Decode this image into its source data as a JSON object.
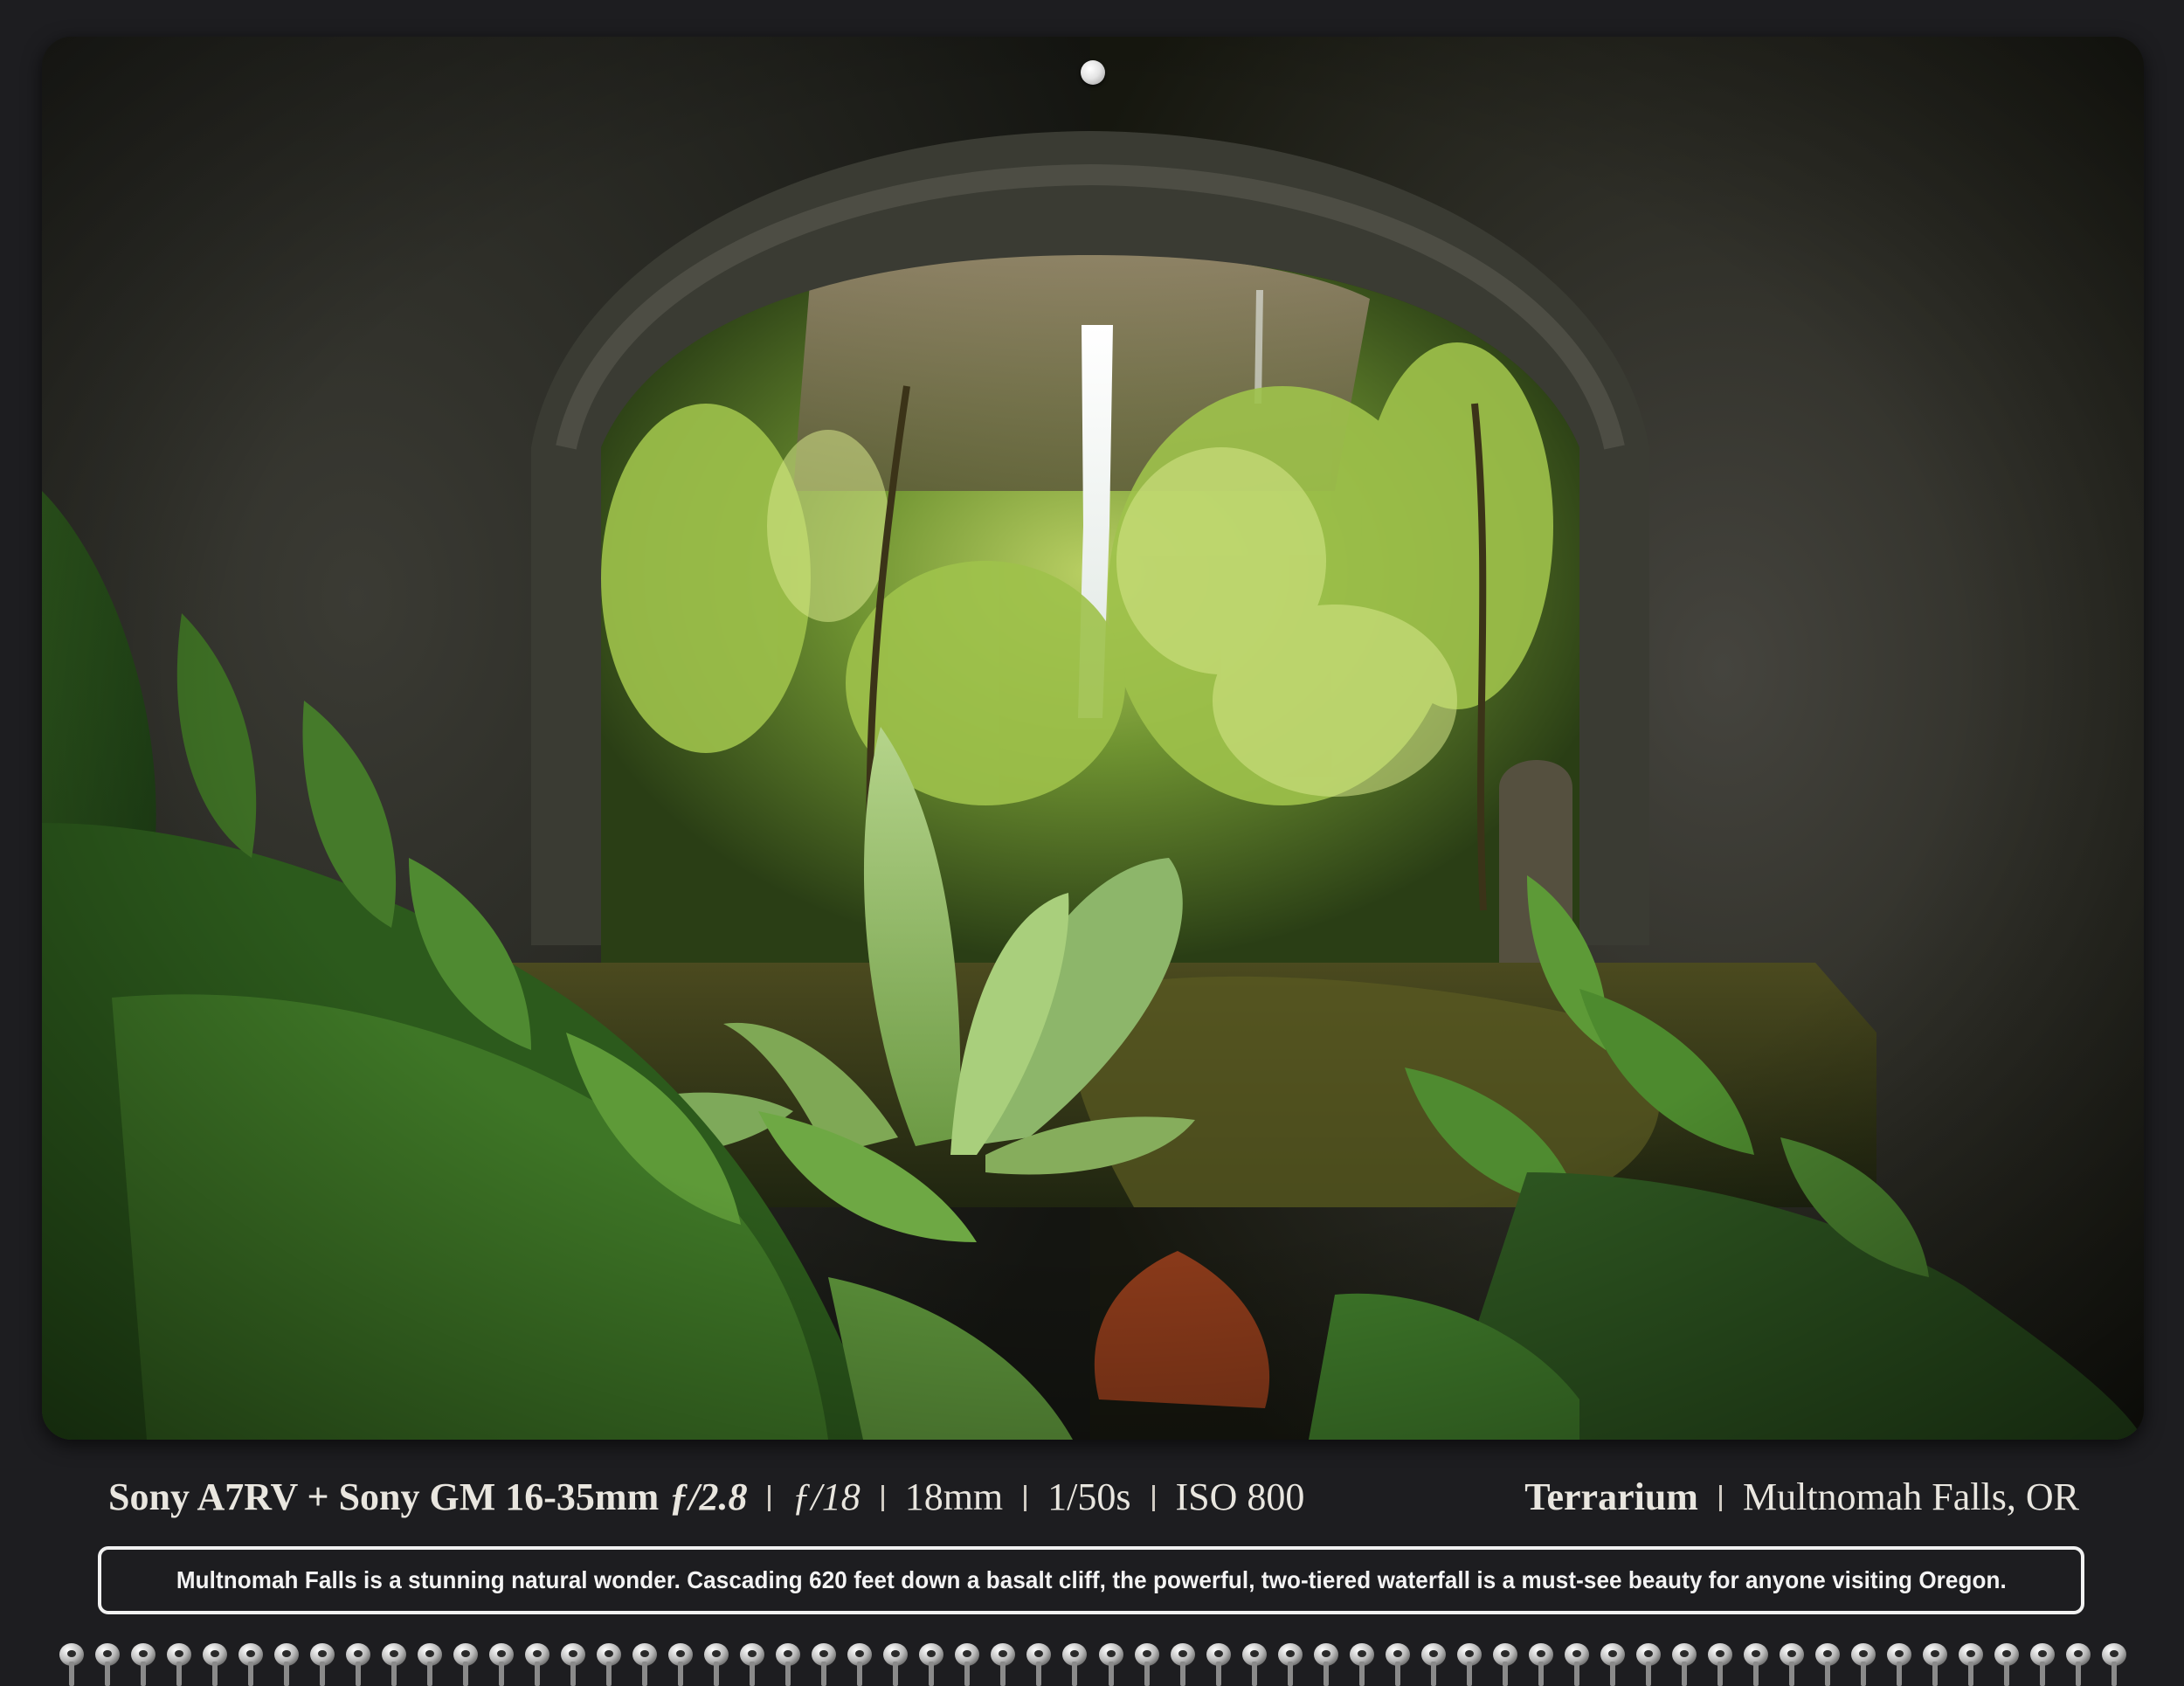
{
  "photo": {
    "subject": "waterfall-through-stone-arch",
    "icon": "photograph"
  },
  "caption": {
    "camera": "Sony A7RV + Sony GM 16-35mm",
    "max_aperture": "ƒ/2.8",
    "aperture": "ƒ/18",
    "focal_length": "18mm",
    "shutter": "1/50s",
    "iso": "ISO 800",
    "title": "Terrarium",
    "location": "Multnomah Falls, OR"
  },
  "description": "Multnomah Falls is a stunning natural wonder.  Cascading 620 feet down a basalt cliff, the powerful, two-tiered waterfall is a must-see beauty for anyone visiting Oregon.",
  "colors": {
    "background": "#1d1d20",
    "caption_text": "#e9e6df",
    "box_border": "#f1f1f1"
  },
  "binding": {
    "ring_count": 58,
    "icon": "spiral-binding-ring"
  }
}
